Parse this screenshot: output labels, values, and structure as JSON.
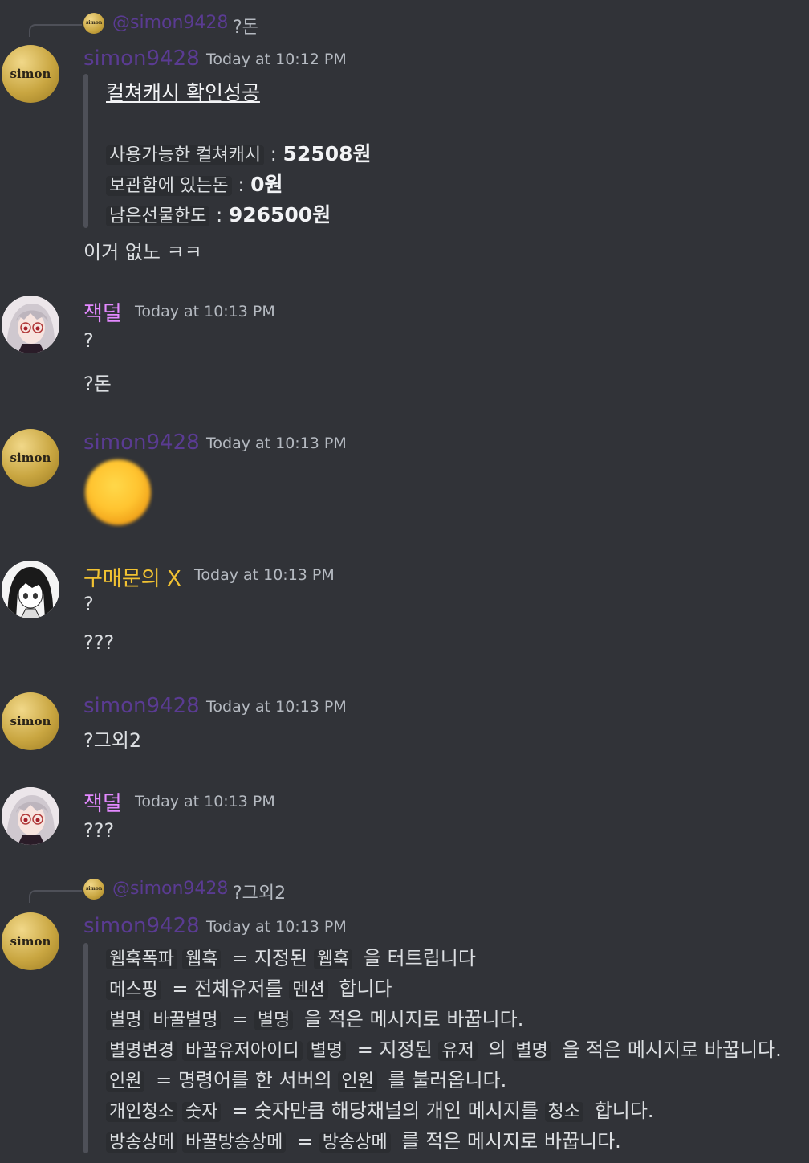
{
  "messages": {
    "m1": {
      "reply": {
        "name": "@simon9428",
        "text": "?돈",
        "avatar_text": "simon"
      },
      "avatar_text": "simon",
      "author": "simon9428",
      "timestamp": "Today at 10:12 PM",
      "embed": {
        "title": "컬쳐캐시 확인성공",
        "rows": [
          {
            "label": "사용가능한  컬쳐캐시",
            "sep": ":",
            "value": "52508원"
          },
          {
            "label": "보관함에  있는돈",
            "sep": ":",
            "value": "0원"
          },
          {
            "label": "남은선물한도",
            "sep": ":",
            "value": "926500원"
          }
        ]
      },
      "text": "이거 없노 ㅋㅋ"
    },
    "m2": {
      "author": "잭덜",
      "timestamp": "Today at 10:13 PM",
      "lines": [
        "?",
        "?돈"
      ]
    },
    "m3": {
      "avatar_text": "simon",
      "author": "simon9428",
      "timestamp": "Today at 10:13 PM",
      "emoji": "blurred-emoji"
    },
    "m4": {
      "author": "구매문의 X",
      "timestamp": "Today at 10:13 PM",
      "lines": [
        "?",
        "???"
      ]
    },
    "m5": {
      "avatar_text": "simon",
      "author": "simon9428",
      "timestamp": "Today at 10:13 PM",
      "text": "?그외2"
    },
    "m6": {
      "author": "잭덜",
      "timestamp": "Today at 10:13 PM",
      "text": "???"
    },
    "m7": {
      "reply": {
        "name": "@simon9428",
        "text": "?그외2",
        "avatar_text": "simon"
      },
      "avatar_text": "simon",
      "author": "simon9428",
      "timestamp": "Today at 10:13 PM",
      "commands": [
        [
          {
            "c": "웹훅폭파"
          },
          {
            "c": "웹훅"
          },
          {
            "t": " = 지정된 "
          },
          {
            "c": "웹훅"
          },
          {
            "t": " 을 터트립니다"
          }
        ],
        [
          {
            "c": "메스핑"
          },
          {
            "t": " = 전체유저를 "
          },
          {
            "c": "멘션"
          },
          {
            "t": " 합니다"
          }
        ],
        [
          {
            "c": "별명"
          },
          {
            "c": "바꿀별명"
          },
          {
            "t": " = "
          },
          {
            "c": "별명"
          },
          {
            "t": " 을 적은 메시지로 바꿉니다."
          }
        ],
        [
          {
            "c": "별명변경"
          },
          {
            "c": "바꿀유저아이디"
          },
          {
            "c": "별명"
          },
          {
            "t": " = 지정된 "
          },
          {
            "c": "유저"
          },
          {
            "t": " 의 "
          },
          {
            "c": "별명"
          },
          {
            "t": " 을 적은 메시지로 바꿉니다."
          }
        ],
        [
          {
            "c": "인원"
          },
          {
            "t": " = 명령어를 한 서버의 "
          },
          {
            "c": "인원"
          },
          {
            "t": " 를 불러옵니다."
          }
        ],
        [
          {
            "c": "개인청소"
          },
          {
            "c": "숫자"
          },
          {
            "t": " = 숫자만큼 해당채널의 개인 메시지를 "
          },
          {
            "c": "청소"
          },
          {
            "t": " 합니다."
          }
        ],
        [
          {
            "c": "방송상메"
          },
          {
            "c": "바꿀방송상메"
          },
          {
            "t": " = "
          },
          {
            "c": "방송상메"
          },
          {
            "t": " 를 적은 메시지로 바꿉니다."
          }
        ]
      ]
    }
  },
  "colors": {
    "background": "#313338",
    "simon_name": "#5a3b92",
    "jak_name": "#e389ff",
    "buy_name": "#f1c232"
  }
}
